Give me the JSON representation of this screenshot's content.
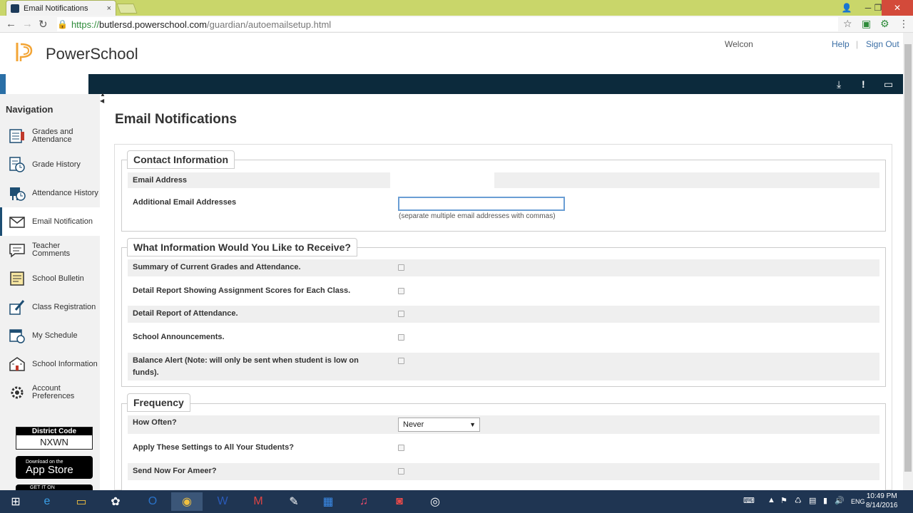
{
  "browser": {
    "tab_title": "Email Notifications",
    "tab_close": "×",
    "url_https": "https://",
    "url_host": "butlersd.powerschool.com",
    "url_path": "/guardian/autoemailsetup.html",
    "min": "─",
    "max": "❐",
    "close": "✕"
  },
  "header": {
    "brand": "PowerSchool",
    "welcome": "Welcon",
    "help": "Help",
    "sep": "|",
    "sign_out": "Sign Out"
  },
  "sidebar": {
    "title": "Navigation",
    "items": [
      {
        "label": "Grades and Attendance"
      },
      {
        "label": "Grade History"
      },
      {
        "label": "Attendance History"
      },
      {
        "label": "Email Notification"
      },
      {
        "label": "Teacher Comments"
      },
      {
        "label": "School Bulletin"
      },
      {
        "label": "Class Registration"
      },
      {
        "label": "My Schedule"
      },
      {
        "label": "School Information"
      },
      {
        "label": "Account Preferences"
      }
    ],
    "district_code_title": "District Code",
    "district_code": "NXWN",
    "app_store_small": "Download on the",
    "app_store_big": "App Store",
    "google_small": "GET IT ON"
  },
  "main": {
    "title": "Email Notifications",
    "contact": {
      "legend": "Contact Information",
      "email_label": "Email Address",
      "additional_label": "Additional Email Addresses",
      "additional_value": "",
      "hint": "(separate multiple email addresses with commas)"
    },
    "receive": {
      "legend": "What Information Would You Like to Receive?",
      "options": [
        "Summary of Current Grades and Attendance.",
        "Detail Report Showing Assignment Scores for Each Class.",
        "Detail Report of Attendance.",
        "School Announcements.",
        "Balance Alert (Note: will only be sent when student is low on funds)."
      ]
    },
    "frequency": {
      "legend": "Frequency",
      "how_often_label": "How Often?",
      "how_often_value": "Never",
      "apply_label": "Apply These Settings to All Your Students?",
      "send_now_label": "Send Now For Ameer?"
    }
  },
  "taskbar": {
    "lang": "ENG",
    "time": "10:49 PM",
    "date": "8/14/2016"
  }
}
